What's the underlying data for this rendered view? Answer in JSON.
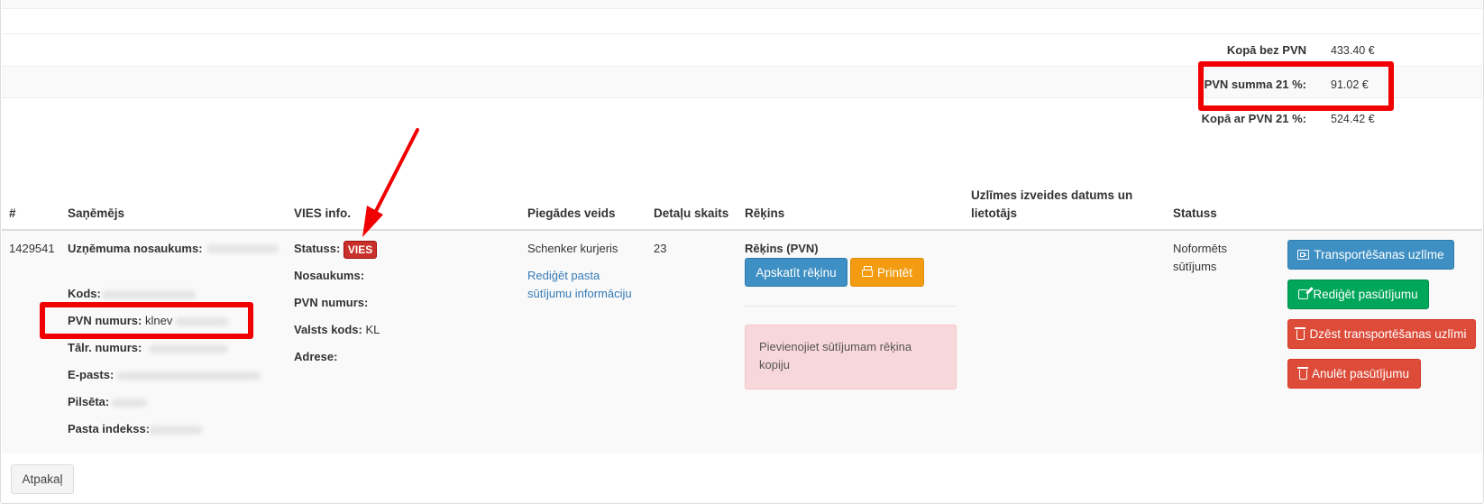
{
  "totals": {
    "without_vat_label": "Kopā bez PVN",
    "without_vat_value": "433.40 €",
    "vat_label": "PVN summa 21 %:",
    "vat_value": "91.02 €",
    "with_vat_label": "Kopā ar PVN 21 %:",
    "with_vat_value": "524.42 €"
  },
  "table": {
    "headers": {
      "number": "#",
      "recipient": "Saņēmējs",
      "vies": "VIES info.",
      "delivery": "Piegādes veids",
      "parts": "Detaļu skaits",
      "invoice": "Rēķins",
      "label_date_line1": "Uzlīmes izveides datums un",
      "label_date_line2": "lietotājs",
      "status": "Statuss"
    },
    "row": {
      "id": "1429541",
      "recipient": {
        "company_label": "Uzņēmuma nosaukums:",
        "code_label": "Kods:",
        "vat_label": "PVN numurs:",
        "vat_value": "klnev",
        "phone_label": "Tālr. numurs:",
        "email_label": "E-pasts:",
        "city_label": "Pilsēta:",
        "postcode_label": "Pasta indekss:"
      },
      "vies": {
        "status_label": "Statuss:",
        "status_badge": "VIES",
        "name_label": "Nosaukums:",
        "vat_label": "PVN numurs:",
        "country_label": "Valsts kods:",
        "country_value": "KL",
        "address_label": "Adrese:"
      },
      "delivery": {
        "carrier": "Schenker kurjeris",
        "edit_link_line1": "Rediģēt pasta",
        "edit_link_line2": "sūtījumu informāciju"
      },
      "parts_count": "23",
      "invoice": {
        "title": "Rēķins (PVN)",
        "view_button": "Apskatīt rēķinu",
        "print_button": "Printēt",
        "alert_line1": "Pievienojiet sūtījumam rēķina",
        "alert_line2": "kopiju"
      },
      "status_line1": "Noformēts",
      "status_line2": "sūtījums",
      "actions": {
        "transport_label": "Transportēšanas uzlīme",
        "edit_order": "Rediģēt pasūtījumu",
        "delete_label": "Dzēst transportēšanas uzlīmi",
        "cancel_order": "Anulēt pasūtījumu"
      }
    }
  },
  "back_button": "Atpakaļ",
  "colors": {
    "highlight": "#f00000",
    "info": "#3e8fc3",
    "warning": "#f39c12",
    "success": "#00a65a",
    "danger": "#dd4b39",
    "link": "#337ab7",
    "badge": "#c9302c"
  },
  "icons": {
    "transport": "id-card-icon",
    "edit": "edit-icon",
    "delete": "trash-icon",
    "print": "print-icon"
  }
}
